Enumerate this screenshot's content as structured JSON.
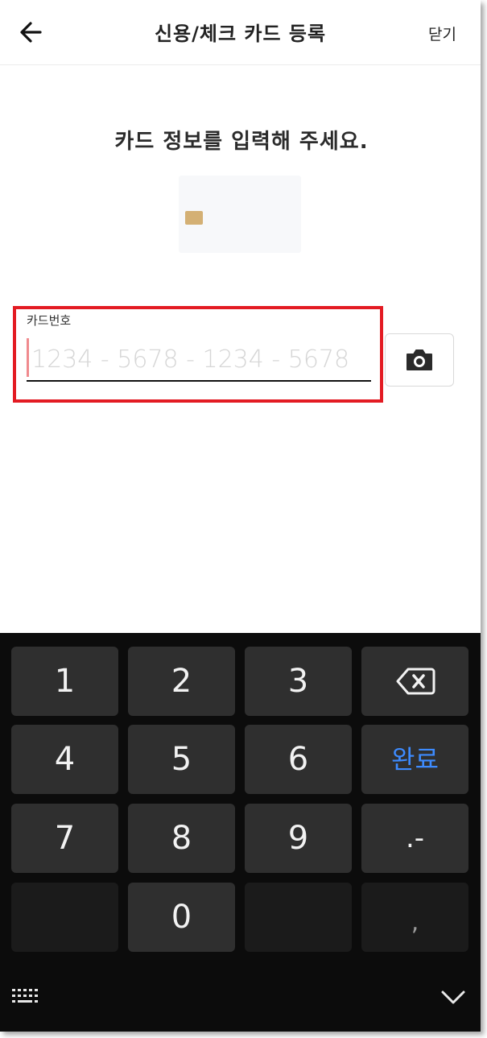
{
  "header": {
    "title": "신용/체크 카드 등록",
    "close_label": "닫기",
    "back_icon": "arrow-left-icon"
  },
  "main": {
    "prompt": "카드 정보를 입력해 주세요.",
    "card_number": {
      "label": "카드번호",
      "placeholder": "1234 - 5678 - 1234 - 5678",
      "value": ""
    },
    "scan_icon": "camera-icon"
  },
  "keyboard": {
    "keys": [
      "1",
      "2",
      "3",
      "4",
      "5",
      "6",
      "7",
      "8",
      "9",
      "0"
    ],
    "done_label": "완료",
    "symbol_key": ".-",
    "comma_key": ",",
    "backspace_icon": "backspace-icon",
    "switch_icon": "keyboard-icon",
    "hide_icon": "chevron-down-icon"
  },
  "colors": {
    "accent_blue": "#3d8bff",
    "highlight_red": "#e31b23",
    "chip_gold": "#d4b074",
    "keyboard_bg": "#0c0c0c",
    "key_bg": "#2f2f2f"
  }
}
